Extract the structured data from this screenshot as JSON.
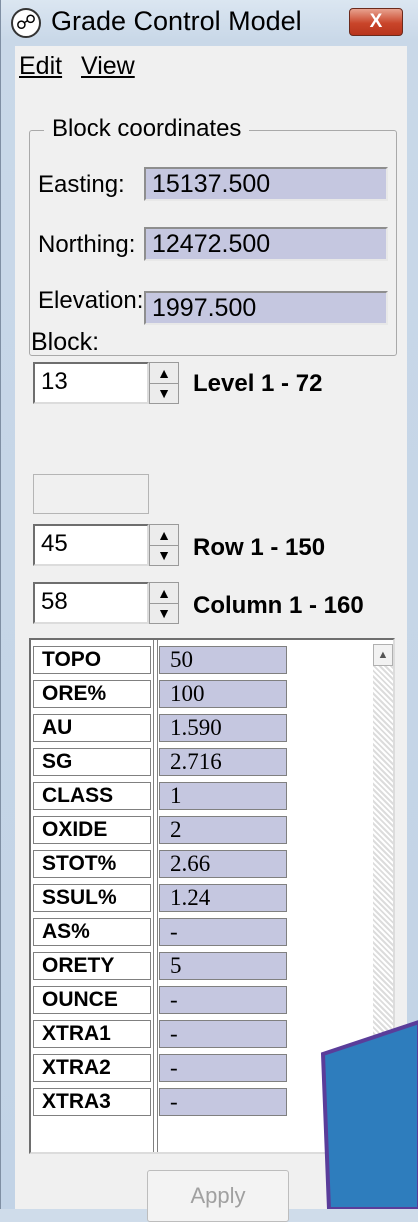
{
  "window": {
    "title": "Grade Control Model",
    "close_glyph": "X",
    "icon": "globe-icon"
  },
  "menu": {
    "edit": "Edit",
    "view": "View"
  },
  "coordinates": {
    "group_title": "Block coordinates",
    "easting_label": "Easting:",
    "easting_value": "15137.500",
    "northing_label": "Northing:",
    "northing_value": "12472.500",
    "elevation_label": "Elevation:",
    "elevation_value": "1997.500"
  },
  "block": {
    "label": "Block:",
    "level_value": "13",
    "level_range": "Level 1 - 72",
    "row_value": "45",
    "row_range": "Row 1 - 150",
    "column_value": "58",
    "column_range": "Column 1 - 160"
  },
  "attributes": [
    {
      "name": "TOPO",
      "value": "50"
    },
    {
      "name": "ORE%",
      "value": "100"
    },
    {
      "name": "AU",
      "value": "1.590"
    },
    {
      "name": "SG",
      "value": "2.716"
    },
    {
      "name": "CLASS",
      "value": "1"
    },
    {
      "name": "OXIDE",
      "value": "2"
    },
    {
      "name": "STOT%",
      "value": "2.66"
    },
    {
      "name": "SSUL%",
      "value": "1.24"
    },
    {
      "name": "AS%",
      "value": "-"
    },
    {
      "name": "ORETY",
      "value": "5"
    },
    {
      "name": "OUNCE",
      "value": "-"
    },
    {
      "name": "XTRA1",
      "value": "-"
    },
    {
      "name": "XTRA2",
      "value": "-"
    },
    {
      "name": "XTRA3",
      "value": "-"
    }
  ],
  "apply_label": "Apply",
  "colors": {
    "value_fill": "#c5c7e0",
    "close_button": "#c9452a",
    "overlay_blue": "#2e7dbd",
    "overlay_border": "#5a3d9a"
  }
}
